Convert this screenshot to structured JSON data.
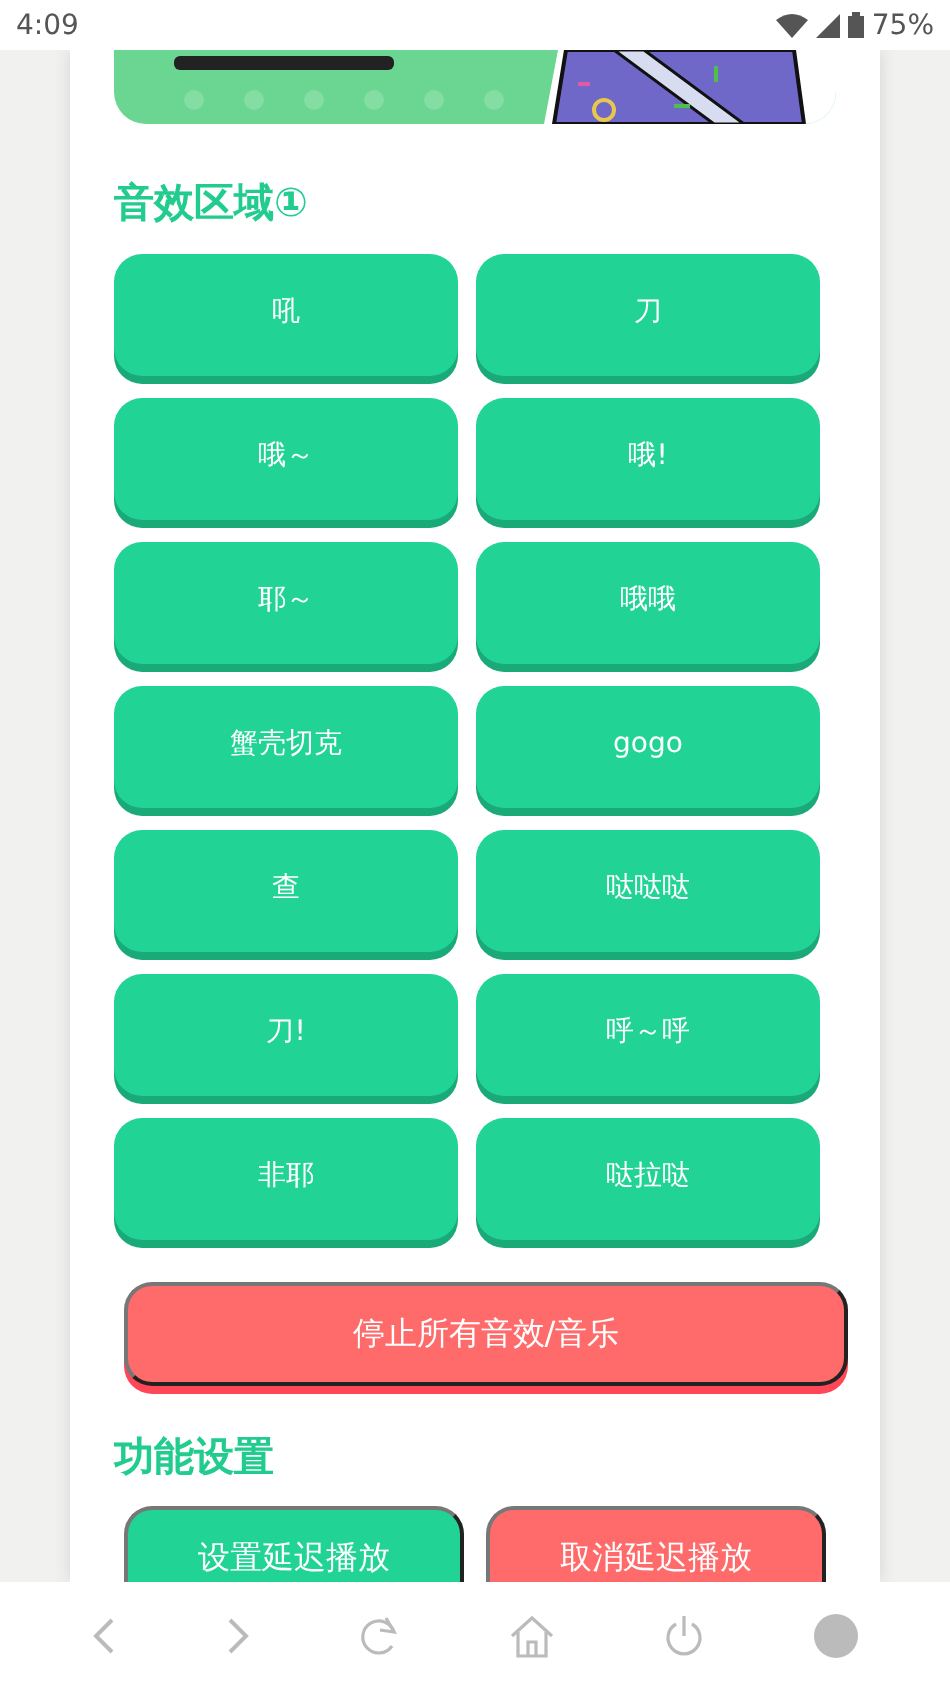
{
  "status_bar": {
    "time": "4:09",
    "battery": "75%"
  },
  "sound_section": {
    "title": "音效区域①",
    "buttons": [
      "吼",
      "刀",
      "哦～",
      "哦!",
      "耶～",
      "哦哦",
      "蟹壳切克",
      "gogo",
      "查",
      "哒哒哒",
      "刀!",
      "呼～呼",
      "非耶",
      "哒拉哒"
    ]
  },
  "stop_button": "停止所有音效/音乐",
  "settings": {
    "title": "功能设置",
    "buttons": [
      {
        "label": "设置延迟播放",
        "kind": "confirm"
      },
      {
        "label": "取消延迟播放",
        "kind": "cancel"
      }
    ]
  }
}
